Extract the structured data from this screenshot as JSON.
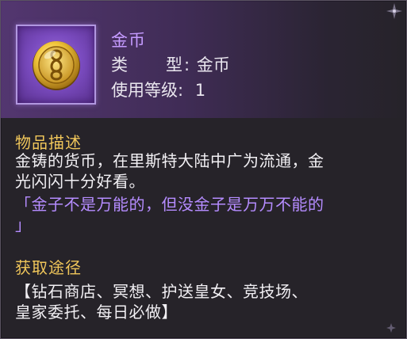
{
  "item": {
    "name": "金币",
    "type_label": "类　　型:",
    "type_value": "金币",
    "level_label": "使用等级:",
    "level_value": "1",
    "icon": "gold-coin-icon"
  },
  "description": {
    "title": "物品描述",
    "lines": [
      "金铸的货币，在里斯特大陆中广为流通，金",
      "光闪闪十分好看。"
    ],
    "quote_lines": [
      "「金子不是万能的，但没金子是万万不能的",
      "」"
    ]
  },
  "obtain": {
    "title": "获取途径",
    "lines": [
      "【钻石商店、冥想、护送皇女、竞技场、",
      "皇家委托、每日必做】"
    ]
  },
  "colors": {
    "name": "#c59bff",
    "section_title": "#f0c65a",
    "quote": "#b58cff",
    "body_text": "#f2f0f4"
  }
}
